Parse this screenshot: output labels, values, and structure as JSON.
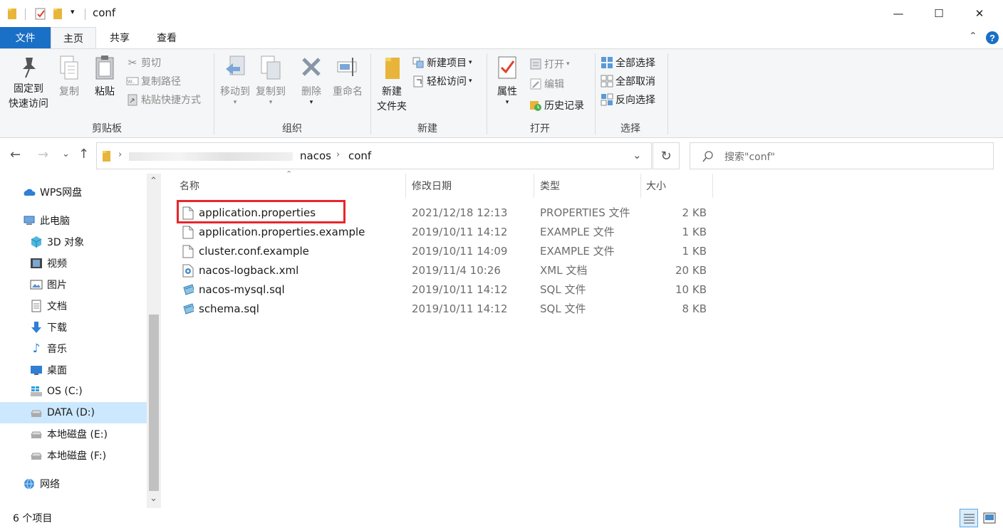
{
  "window": {
    "title": "conf",
    "controls": {
      "minimize": "—",
      "maximize": "☐",
      "close": "✕"
    }
  },
  "tabs": [
    {
      "label": "文件"
    },
    {
      "label": "主页"
    },
    {
      "label": "共享"
    },
    {
      "label": "查看"
    }
  ],
  "ribbon": {
    "clipboard": {
      "group_label": "剪贴板",
      "pin_line1": "固定到",
      "pin_line2": "快速访问",
      "copy": "复制",
      "paste": "粘贴",
      "cut": "剪切",
      "copy_path": "复制路径",
      "paste_shortcut": "粘贴快捷方式"
    },
    "organize": {
      "group_label": "组织",
      "move_to": "移动到",
      "copy_to": "复制到",
      "delete": "删除",
      "rename": "重命名"
    },
    "new": {
      "group_label": "新建",
      "new_folder_line1": "新建",
      "new_folder_line2": "文件夹",
      "new_item": "新建项目",
      "easy_access": "轻松访问"
    },
    "open": {
      "group_label": "打开",
      "properties": "属性",
      "open": "打开",
      "edit": "编辑",
      "history": "历史记录"
    },
    "select": {
      "group_label": "选择",
      "select_all": "全部选择",
      "select_none": "全部取消",
      "invert": "反向选择"
    }
  },
  "address": {
    "crumbs": [
      "nacos",
      "conf"
    ],
    "search_placeholder": "搜索\"conf\""
  },
  "nav": {
    "items": [
      {
        "label": "WPS网盘"
      },
      {
        "label": "此电脑"
      },
      {
        "label": "3D 对象"
      },
      {
        "label": "视频"
      },
      {
        "label": "图片"
      },
      {
        "label": "文档"
      },
      {
        "label": "下载"
      },
      {
        "label": "音乐"
      },
      {
        "label": "桌面"
      },
      {
        "label": "OS (C:)"
      },
      {
        "label": "DATA (D:)"
      },
      {
        "label": "本地磁盘 (E:)"
      },
      {
        "label": "本地磁盘 (F:)"
      },
      {
        "label": "网络"
      }
    ]
  },
  "columns": {
    "name": "名称",
    "date": "修改日期",
    "type": "类型",
    "size": "大小"
  },
  "files": [
    {
      "name": "application.properties",
      "date": "2021/12/18 12:13",
      "type": "PROPERTIES 文件",
      "size": "2 KB",
      "icon": "blank-file-icon",
      "highlighted": true
    },
    {
      "name": "application.properties.example",
      "date": "2019/10/11 14:12",
      "type": "EXAMPLE 文件",
      "size": "1 KB",
      "icon": "blank-file-icon"
    },
    {
      "name": "cluster.conf.example",
      "date": "2019/10/11 14:09",
      "type": "EXAMPLE 文件",
      "size": "1 KB",
      "icon": "blank-file-icon"
    },
    {
      "name": "nacos-logback.xml",
      "date": "2019/11/4 10:26",
      "type": "XML 文档",
      "size": "20 KB",
      "icon": "xml-file-icon"
    },
    {
      "name": "nacos-mysql.sql",
      "date": "2019/10/11 14:12",
      "type": "SQL 文件",
      "size": "10 KB",
      "icon": "sql-file-icon"
    },
    {
      "name": "schema.sql",
      "date": "2019/10/11 14:12",
      "type": "SQL 文件",
      "size": "8 KB",
      "icon": "sql-file-icon"
    }
  ],
  "status": {
    "count": "6 个项目"
  },
  "colors": {
    "accent": "#1a6fc6",
    "highlight_box": "#e8262c",
    "selected_nav": "#cce8ff"
  }
}
